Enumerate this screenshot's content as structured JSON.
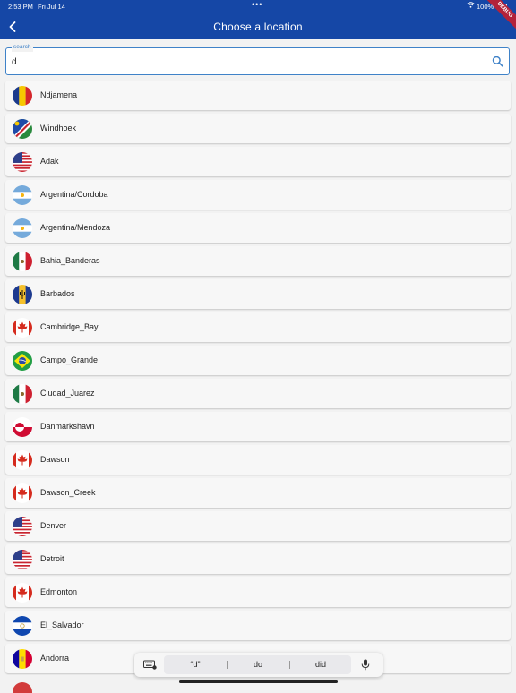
{
  "status": {
    "time": "2:53 PM",
    "date": "Fri Jul 14",
    "dots": "•••",
    "battery": "100%"
  },
  "header": {
    "title": "Choose a location",
    "debug": "DEBUG"
  },
  "search": {
    "label": "search",
    "value": "d"
  },
  "locations": [
    {
      "label": "Ndjamena",
      "flag": "chad-flag-icon"
    },
    {
      "label": "Windhoek",
      "flag": "namibia-flag-icon"
    },
    {
      "label": "Adak",
      "flag": "usa-flag-icon"
    },
    {
      "label": "Argentina/Cordoba",
      "flag": "argentina-flag-icon"
    },
    {
      "label": "Argentina/Mendoza",
      "flag": "argentina-flag-icon"
    },
    {
      "label": "Bahia_Banderas",
      "flag": "mexico-flag-icon"
    },
    {
      "label": "Barbados",
      "flag": "barbados-flag-icon"
    },
    {
      "label": "Cambridge_Bay",
      "flag": "canada-flag-icon"
    },
    {
      "label": "Campo_Grande",
      "flag": "brazil-flag-icon"
    },
    {
      "label": "Ciudad_Juarez",
      "flag": "mexico-flag-icon"
    },
    {
      "label": "Danmarkshavn",
      "flag": "greenland-flag-icon"
    },
    {
      "label": "Dawson",
      "flag": "canada-flag-icon"
    },
    {
      "label": "Dawson_Creek",
      "flag": "canada-flag-icon"
    },
    {
      "label": "Denver",
      "flag": "usa-flag-icon"
    },
    {
      "label": "Detroit",
      "flag": "usa-flag-icon"
    },
    {
      "label": "Edmonton",
      "flag": "canada-flag-icon"
    },
    {
      "label": "El_Salvador",
      "flag": "el-salvador-flag-icon"
    },
    {
      "label": "Andorra",
      "flag": "andorra-flag-icon"
    }
  ],
  "keyboard": {
    "suggestions": [
      "“d”",
      "do",
      "did"
    ]
  },
  "colors": {
    "appbar": "#1547a6",
    "accent": "#3f82c8"
  }
}
